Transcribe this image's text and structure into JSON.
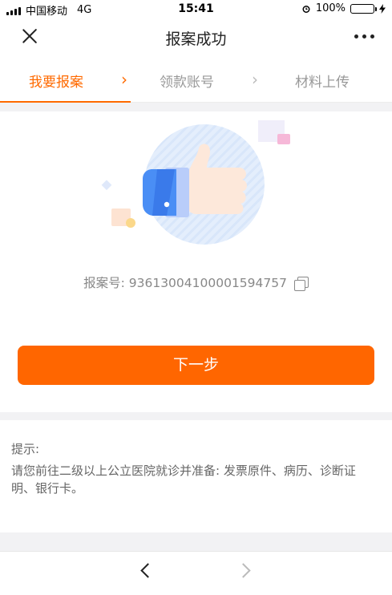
{
  "status_bar": {
    "carrier": "中国移动",
    "network": "4G",
    "time": "15:41",
    "battery": "100%"
  },
  "nav": {
    "title": "报案成功",
    "close_icon": "close-icon",
    "more_icon": "more-icon"
  },
  "steps": [
    {
      "label": "我要报案",
      "active": true
    },
    {
      "label": "领款账号",
      "active": false
    },
    {
      "label": "材料上传",
      "active": false
    }
  ],
  "case": {
    "label": "报案号:",
    "number": "93613004100001594757"
  },
  "next_button": "下一步",
  "tips": {
    "title": "提示:",
    "body": "请您前往二级以上公立医院就诊并准备: 发票原件、病历、诊断证明、银行卡。"
  },
  "colors": {
    "accent": "#ff6600",
    "active_step": "#ff6a00",
    "battery": "#2dc84d"
  }
}
